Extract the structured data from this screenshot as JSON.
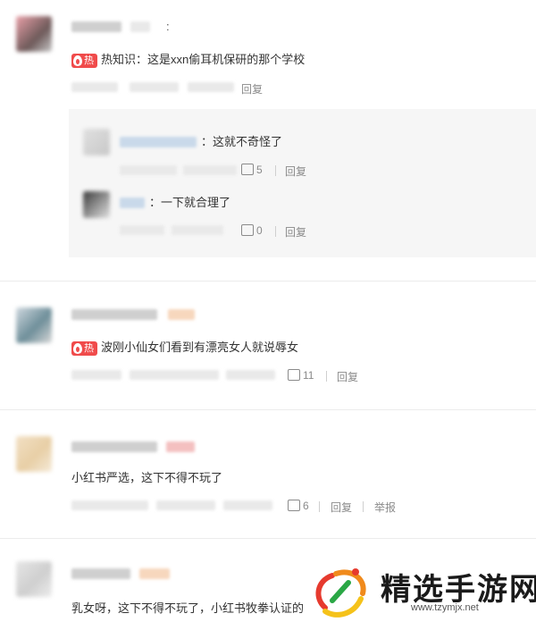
{
  "comments": [
    {
      "hot_tag": "热",
      "text": "热知识：这是xxn偷耳机保研的那个学校",
      "reply_label": "回复",
      "replies": [
        {
          "text": "：这就不奇怪了",
          "likes": "5",
          "reply_label": "回复"
        },
        {
          "text": "：一下就合理了",
          "likes": "0",
          "reply_label": "回复"
        }
      ]
    },
    {
      "hot_tag": "热",
      "text": "波刚小仙女们看到有漂亮女人就说辱女",
      "likes": "11",
      "reply_label": "回复"
    },
    {
      "text": "小红书严选，这下不得不玩了",
      "likes": "6",
      "reply_label": "回复",
      "report_label": "举报"
    },
    {
      "text": "乳女呀，这下不得不玩了，小红书牧拳认证的"
    }
  ],
  "watermark": {
    "title": "精选手游网",
    "url": "www.tzymjx.net"
  }
}
